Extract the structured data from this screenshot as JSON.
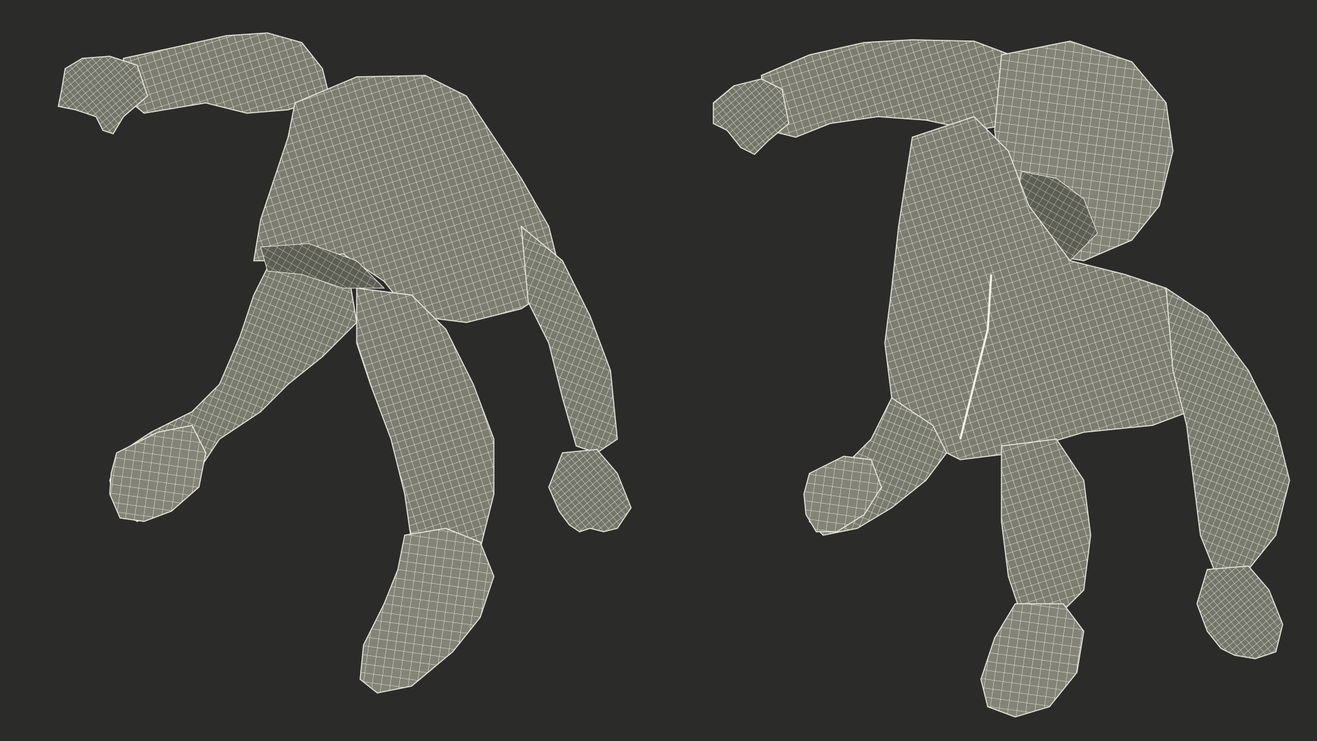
{
  "scene": {
    "background_color": "#2b2b2a",
    "mesh_fill_color": "#7c7d70",
    "mesh_shade_color": "#66675c",
    "wire_color": "#e8e8dc",
    "views": [
      {
        "name": "wireframe-view-underside",
        "description_icon": "wireframe-figure-icon"
      },
      {
        "name": "wireframe-view-front-hood",
        "description_icon": "wireframe-figure-icon"
      }
    ]
  }
}
